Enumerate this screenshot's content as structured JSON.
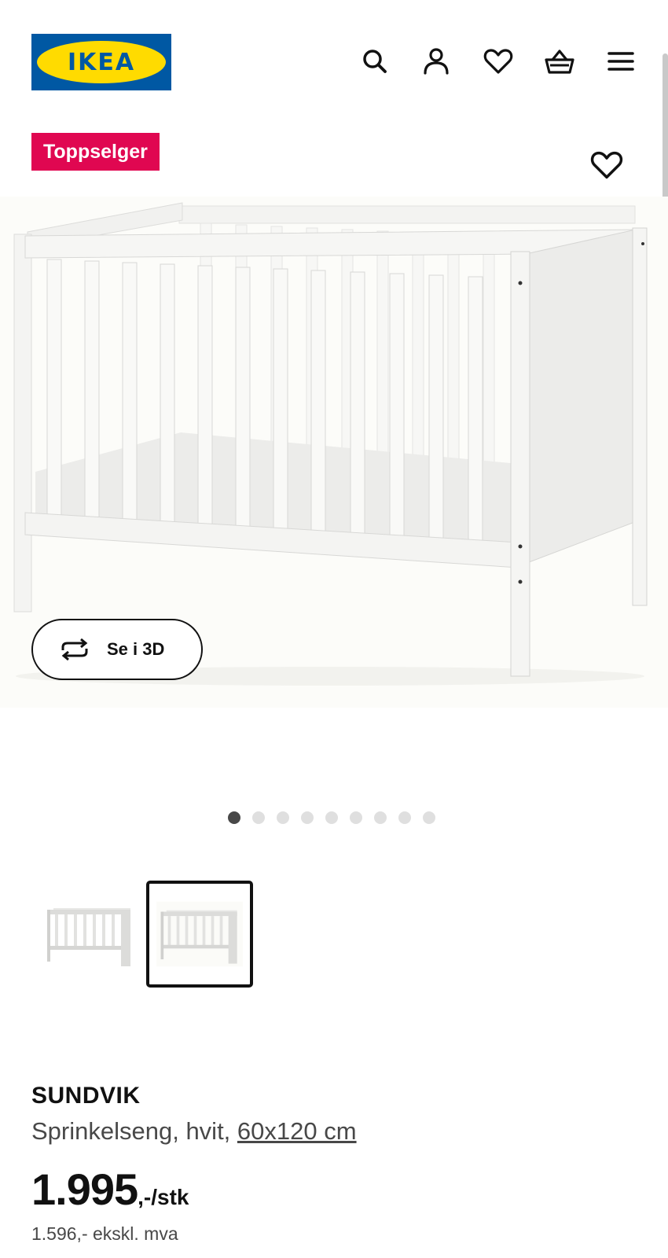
{
  "header": {
    "logo_text": "IKEA",
    "icons": [
      "search-icon",
      "account-icon",
      "heart-icon",
      "basket-icon",
      "menu-icon"
    ]
  },
  "badge": {
    "label": "Toppselger",
    "color": "#e00751"
  },
  "product_image": {
    "view_3d_label": "Se i 3D"
  },
  "carousel": {
    "total": 9,
    "active": 1
  },
  "thumbnails": {
    "count": 2,
    "selected": 2
  },
  "product": {
    "name": "SUNDVIK",
    "description": "Sprinkelseng, hvit, ",
    "size_link": "60x120 cm",
    "price": "1.995",
    "price_unit": ",-/stk",
    "price_ex_vat": "1.596,- ekskl. mva"
  },
  "colors": {
    "brand_blue": "#0058a3",
    "brand_yellow": "#ffdb00",
    "badge_red": "#e00751"
  }
}
